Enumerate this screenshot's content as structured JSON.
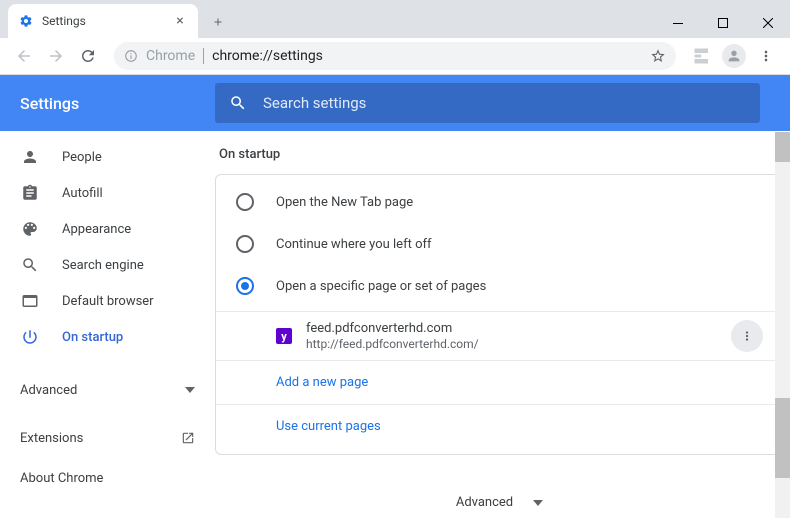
{
  "window": {
    "tab_title": "Settings",
    "omnibox_prefix": "Chrome",
    "omnibox_url": "chrome://settings"
  },
  "header": {
    "title": "Settings",
    "search_placeholder": "Search settings"
  },
  "sidebar": {
    "items": [
      {
        "label": "People"
      },
      {
        "label": "Autofill"
      },
      {
        "label": "Appearance"
      },
      {
        "label": "Search engine"
      },
      {
        "label": "Default browser"
      },
      {
        "label": "On startup"
      }
    ],
    "advanced": "Advanced",
    "extensions": "Extensions",
    "about": "About Chrome"
  },
  "content": {
    "section_title": "On startup",
    "radios": [
      {
        "label": "Open the New Tab page"
      },
      {
        "label": "Continue where you left off"
      },
      {
        "label": "Open a specific page or set of pages"
      }
    ],
    "page": {
      "title": "feed.pdfconverterhd.com",
      "url": "http://feed.pdfconverterhd.com/"
    },
    "add_new_page": "Add a new page",
    "use_current": "Use current pages",
    "advanced_footer": "Advanced"
  }
}
